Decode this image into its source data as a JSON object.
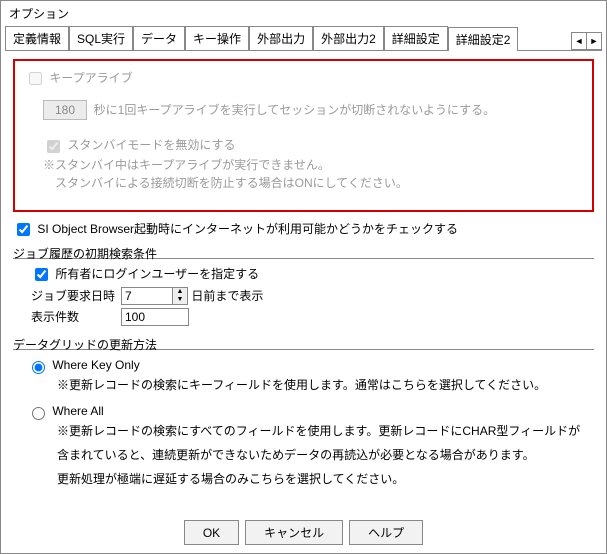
{
  "window": {
    "title": "オプション"
  },
  "tabs": [
    "定義情報",
    "SQL実行",
    "データ",
    "キー操作",
    "外部出力",
    "外部出力2",
    "詳細設定",
    "詳細設定2"
  ],
  "keepalive": {
    "label": "キープアライブ",
    "interval": "180",
    "interval_text": "秒に1回キープアライブを実行してセッションが切断されないようにする。",
    "standby_label": "スタンバイモードを無効にする",
    "standby_note1": "※スタンバイ中はキープアライブが実行できません。",
    "standby_note2": "スタンバイによる接続切断を防止する場合はONにしてください。"
  },
  "internet_check": {
    "label": "SI Object Browser起動時にインターネットが利用可能かどうかをチェックする"
  },
  "job_history": {
    "legend": "ジョブ履歴の初期検索条件",
    "owner_login": "所有者にログインユーザーを指定する",
    "req_date_label": "ジョブ要求日時",
    "req_date_value": "7",
    "req_date_suffix": "日前まで表示",
    "disp_count_label": "表示件数",
    "disp_count_value": "100"
  },
  "datagrid": {
    "legend": "データグリッドの更新方法",
    "opt1": {
      "label": "Where Key Only",
      "note": "※更新レコードの検索にキーフィールドを使用します。通常はこちらを選択してください。"
    },
    "opt2": {
      "label": "Where All",
      "note1": "※更新レコードの検索にすべてのフィールドを使用します。更新レコードにCHAR型フィールドが",
      "note2": "含まれていると、連続更新ができないためデータの再読込が必要となる場合があります。",
      "note3": "更新処理が極端に遅延する場合のみこちらを選択してください。"
    }
  },
  "buttons": {
    "ok": "OK",
    "cancel": "キャンセル",
    "help": "ヘルプ"
  }
}
